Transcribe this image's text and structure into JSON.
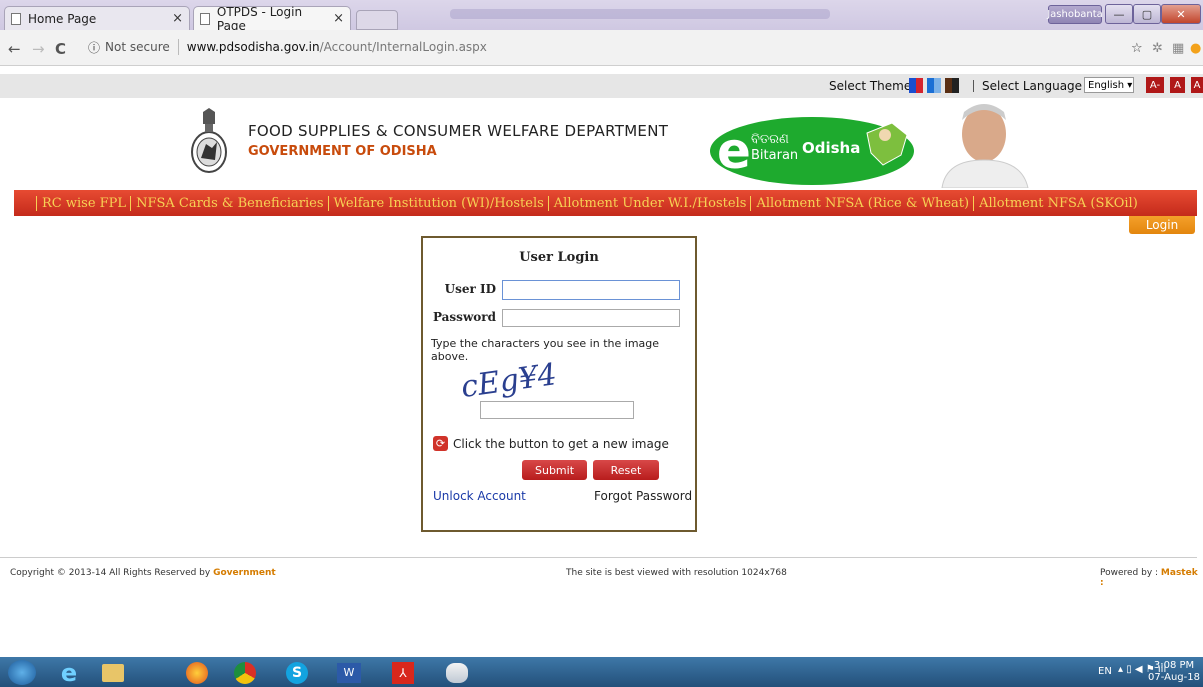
{
  "browser": {
    "tabs": [
      {
        "label": "Home Page",
        "close": "×"
      },
      {
        "label": "OTPDS - Login Page",
        "close": "×"
      }
    ],
    "user_badge": "Jashobanta",
    "url_security": "Not secure",
    "url_host": "www.pdsodisha.gov.in",
    "url_path": "/Account/InternalLogin.aspx",
    "nav": {
      "back": "←",
      "forward": "→",
      "reload": "C"
    }
  },
  "site": {
    "theme_label": "Select Theme",
    "language_label": "Select Language",
    "language_value": "English ▾",
    "font_buttons": [
      "A-",
      "A",
      "A"
    ],
    "department": "FOOD SUPPLIES & CONSUMER WELFARE DEPARTMENT",
    "government": "GOVERNMENT OF ODISHA",
    "logo_text": {
      "e": "e",
      "odia": "ବିତରଣ",
      "bitaran": "Bitaran",
      "odisha": "Odisha"
    },
    "menu": [
      "RC wise FPL",
      "NFSA Cards & Beneficiaries",
      "Welfare Institution (WI)/Hostels",
      "Allotment Under W.I./Hostels",
      "Allotment NFSA (Rice & Wheat)",
      "Allotment NFSA (SKOil)"
    ],
    "login_button": "Login"
  },
  "login": {
    "title": "User Login",
    "user_id_label": "User ID",
    "password_label": "Password",
    "captcha_instruction": "Type the characters you see in the image above.",
    "captcha_image_text": "cEg¥4",
    "refresh_text": "Click the button to get a new image",
    "submit": "Submit",
    "reset": "Reset",
    "unlock": "Unlock Account",
    "forgot": "Forgot Password"
  },
  "footer": {
    "copyright": "Copyright © 2013-14 All Rights Reserved by ",
    "copyright_link": "Government",
    "resolution": "The site is best viewed with resolution 1024x768",
    "powered": "Powered by : ",
    "powered_link": "Mastek :"
  },
  "taskbar": {
    "lang": "EN",
    "time": "3:08 PM",
    "date": "07-Aug-18"
  },
  "colors": {
    "menu_bg": "#d8341f",
    "menu_text": "#f7d154",
    "login_border": "#6e5a2f",
    "accent_orange": "#e3860e"
  }
}
